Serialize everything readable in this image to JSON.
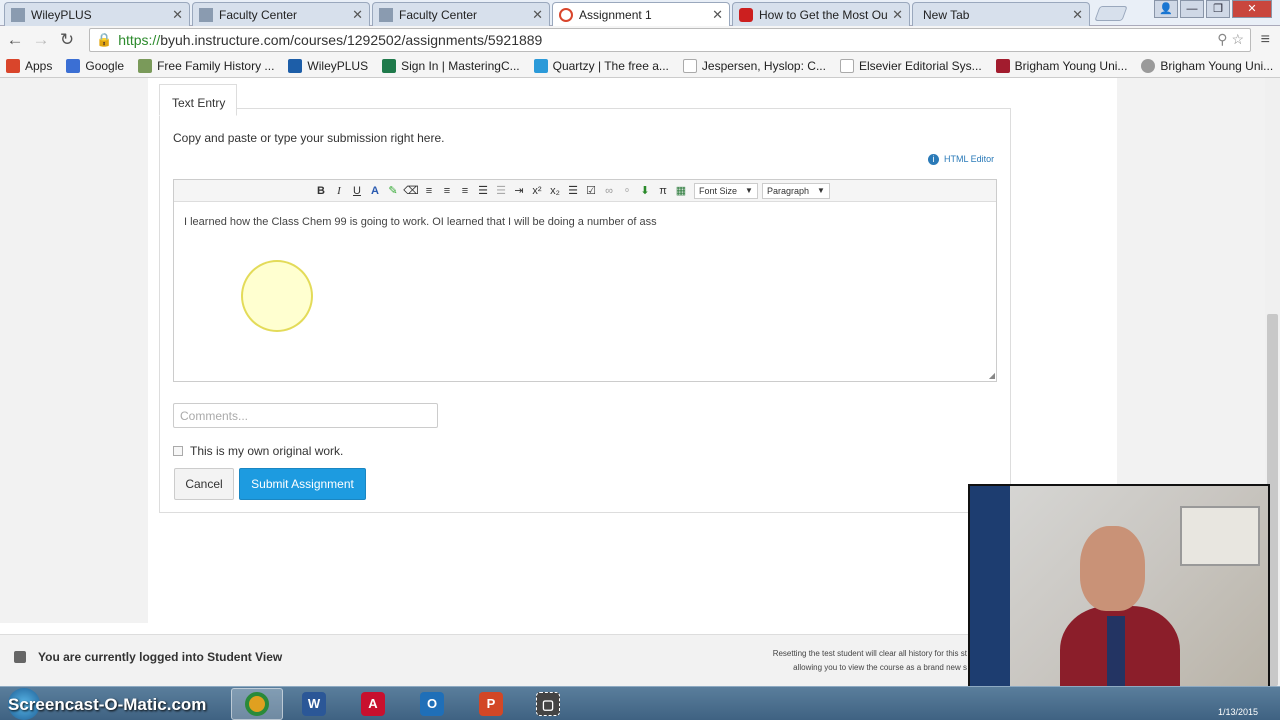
{
  "tabs": [
    {
      "label": "WileyPLUS",
      "icon": "page-icon",
      "color": "#8a9bb0"
    },
    {
      "label": "Faculty Center",
      "icon": "page-icon",
      "color": "#8a9bb0"
    },
    {
      "label": "Faculty Center",
      "icon": "page-icon",
      "color": "#8a9bb0"
    },
    {
      "label": "Assignment 1",
      "icon": "loading-icon",
      "color": "#d9452b"
    },
    {
      "label": "How to Get the Most Out",
      "icon": "youtube-icon",
      "color": "#cc1f1f"
    },
    {
      "label": "New Tab",
      "icon": "none",
      "color": ""
    }
  ],
  "address": {
    "https": "https://",
    "rest": "byuh.instructure.com/courses/1292502/assignments/5921889"
  },
  "bookmarks": [
    {
      "label": "Apps",
      "color": "#d9452b"
    },
    {
      "label": "Google",
      "color": "#3b6fd4"
    },
    {
      "label": "Free Family History ...",
      "color": "#7a9a5a"
    },
    {
      "label": "WileyPLUS",
      "color": "#1d5ea8"
    },
    {
      "label": "Sign In | MasteringC...",
      "color": "#1f7a4b"
    },
    {
      "label": "Quartzy | The free a...",
      "color": "#2b9ad9"
    },
    {
      "label": "Jespersen, Hyslop: C...",
      "color": "#d0d0d0"
    },
    {
      "label": "Elsevier Editorial Sys...",
      "color": "#d0d0d0"
    },
    {
      "label": "Brigham Young Uni...",
      "color": "#a21c2e"
    },
    {
      "label": "Brigham Young Uni...",
      "color": "#9a9a9a"
    }
  ],
  "form": {
    "tab_label": "Text Entry",
    "instructions": "Copy and paste or type your submission right here.",
    "html_editor": "HTML Editor",
    "toolbar": {
      "buttons": [
        "B",
        "I",
        "U",
        "A",
        "✎",
        "⌫",
        "≡",
        "≡",
        "≡",
        "☰",
        "☰",
        "⇥",
        "x²",
        "x₂",
        "☰",
        "☑",
        "∞",
        "⚬",
        "⬇",
        "π",
        "▦"
      ],
      "font_size": "Font Size",
      "paragraph": "Paragraph"
    },
    "editor_text": "I learned how the Class Chem 99 is going to work. OI learned that I will be doing a number of ass",
    "comments_placeholder": "Comments...",
    "checkbox_label": "This is my own original work.",
    "cancel": "Cancel",
    "submit": "Submit Assignment"
  },
  "student_view": {
    "message": "You are currently logged into Student View",
    "reset_text": "Resetting the test student will clear all history for this st allowing you to view the course as a brand new s"
  },
  "taskbar": {
    "watermark": "Screencast-O-Matic.com",
    "apps": [
      {
        "name": "chrome",
        "label": "",
        "color": "#e0a020"
      },
      {
        "name": "word",
        "label": "W",
        "color": "#2b5797"
      },
      {
        "name": "acrobat",
        "label": "A",
        "color": "#c8102e"
      },
      {
        "name": "outlook",
        "label": "O",
        "color": "#1f6fb8"
      },
      {
        "name": "powerpoint",
        "label": "P",
        "color": "#d24726"
      },
      {
        "name": "screencast",
        "label": "▢",
        "color": "#444444"
      }
    ],
    "clock": "1/13/2015"
  }
}
